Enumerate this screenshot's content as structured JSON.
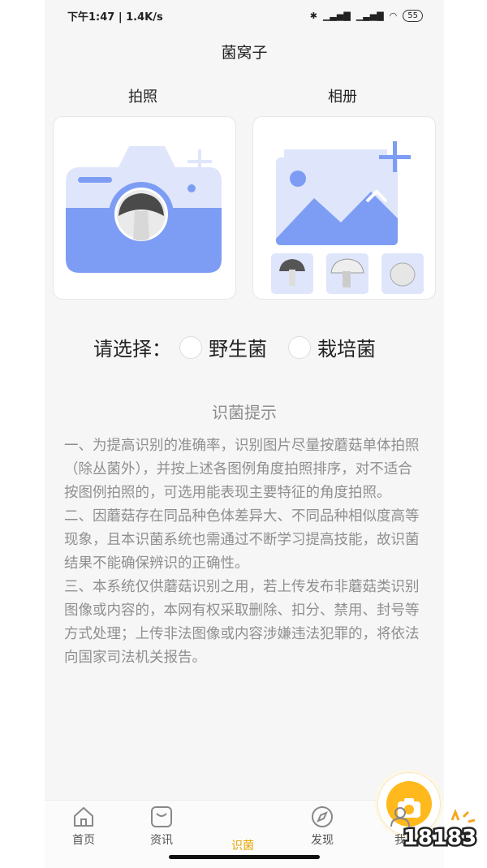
{
  "status_bar": {
    "time_speed": "下午1:47 | 1.4K/s",
    "battery": "55"
  },
  "header": {
    "title": "菌窝子"
  },
  "options": {
    "camera_label": "拍照",
    "album_label": "相册"
  },
  "select": {
    "prompt": "请选择：",
    "wild_label": "野生菌",
    "cultivated_label": "栽培菌"
  },
  "tips": {
    "title": "识菌提示",
    "p1": "一、为提高识别的准确率，识别图片尽量按蘑菇单体拍照（除丛菌外），并按上述各图例角度拍照排序，对不适合按图例拍照的，可选用能表现主要特征的角度拍照。",
    "p2": "二、因蘑菇存在同品种色体差异大、不同品种相似度高等现象，且本识菌系统也需通过不断学习提高技能，故识菌结果不能确保辨识的正确性。",
    "p3": "三、本系统仅供蘑菇识别之用，若上传发布非蘑菇类识别图像或内容的，本网有权采取删除、扣分、禁用、封号等方式处理；上传非法图像或内容涉嫌违法犯罪的，将依法向国家司法机关报告。"
  },
  "tabbar": {
    "items": [
      {
        "label": "首页",
        "icon": "home-icon"
      },
      {
        "label": "资讯",
        "icon": "news-icon"
      },
      {
        "label": "识菌",
        "icon": "camera-icon"
      },
      {
        "label": "发现",
        "icon": "compass-icon"
      },
      {
        "label": "我",
        "icon": "user-icon"
      }
    ]
  },
  "colors": {
    "accent": "#ffb91c",
    "illustration_blue": "#7d9df5",
    "illustration_light": "#dfe6fb"
  },
  "watermark": "18183"
}
